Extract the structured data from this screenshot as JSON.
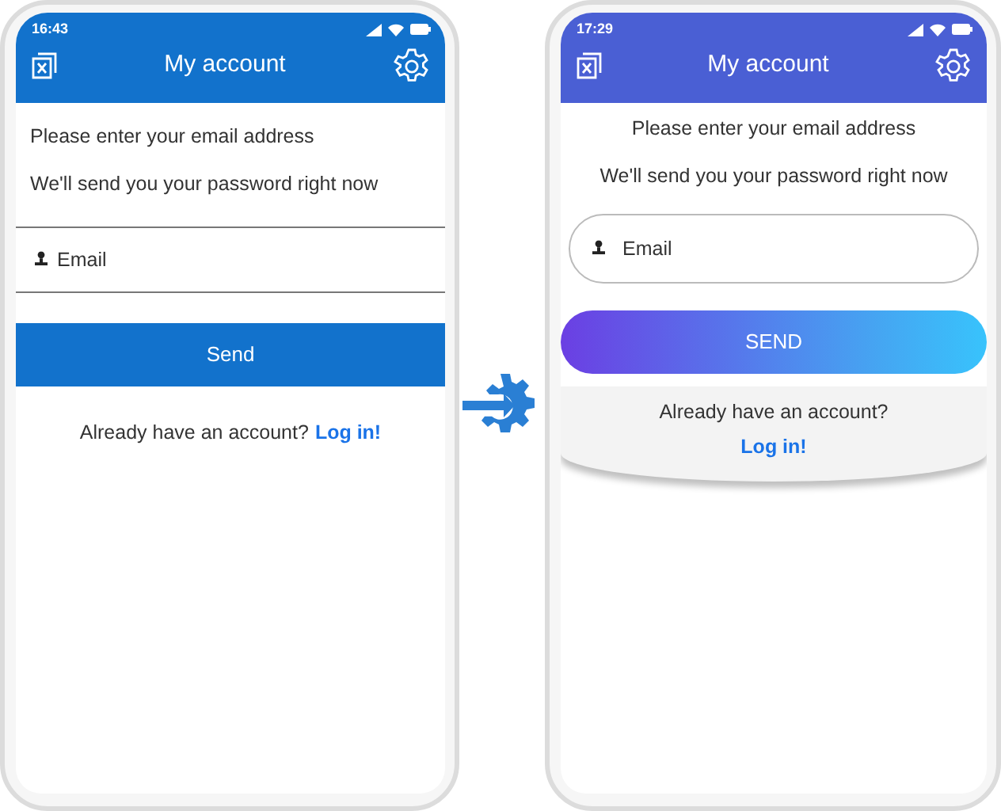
{
  "phones": [
    {
      "kind": "plain",
      "time": "16:43",
      "title": "My account",
      "lines": [
        "Please enter your email address",
        "We'll send you your password right now"
      ],
      "email_placeholder": "Email",
      "button": "Send",
      "prompt": "Already have an account?",
      "link": "Log in!"
    },
    {
      "kind": "styled",
      "time": "17:29",
      "title": "My account",
      "lines": [
        "Please enter your email address",
        "We'll send you your password right now"
      ],
      "email_placeholder": "Email",
      "button": "SEND",
      "prompt": "Already have an account?",
      "link": "Log in!"
    }
  ]
}
